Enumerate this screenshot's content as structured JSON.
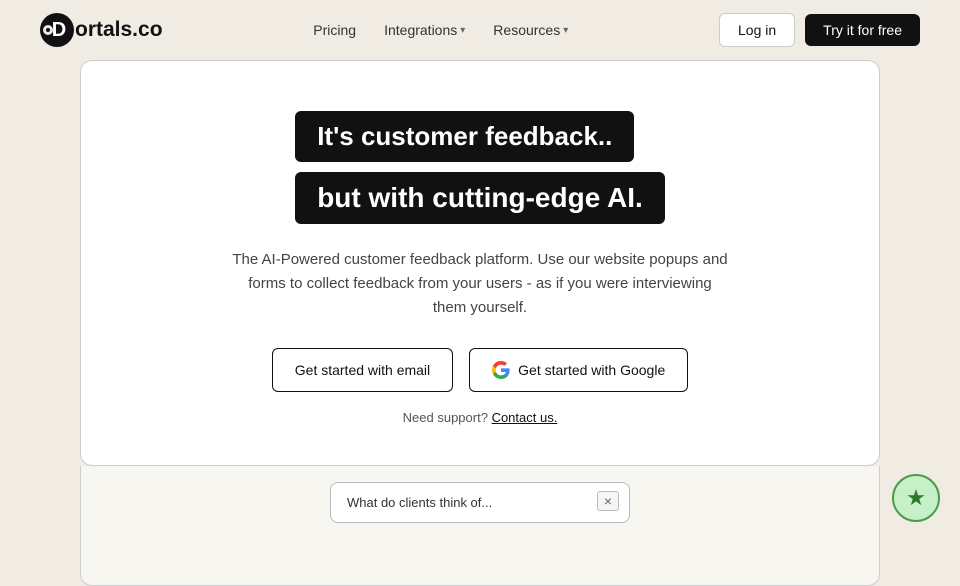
{
  "nav": {
    "logo_text": "ortals.co",
    "links": [
      {
        "label": "Pricing",
        "has_dropdown": false
      },
      {
        "label": "Integrations",
        "has_dropdown": true
      },
      {
        "label": "Resources",
        "has_dropdown": true
      }
    ],
    "login_label": "Log in",
    "try_label": "Try it for free"
  },
  "hero": {
    "headline1": "It's customer feedback..",
    "headline2": "but with cutting-edge AI.",
    "subtext": "The AI-Powered customer feedback platform. Use our website popups and forms to collect feedback from your users - as if you were interviewing them yourself.",
    "btn_email": "Get started with email",
    "btn_google": "Get started with Google",
    "support_text": "Need support?",
    "contact_link": "Contact us."
  },
  "popup": {
    "text": "What do clients think of...",
    "close_label": "×"
  },
  "fab": {
    "icon": "★"
  }
}
